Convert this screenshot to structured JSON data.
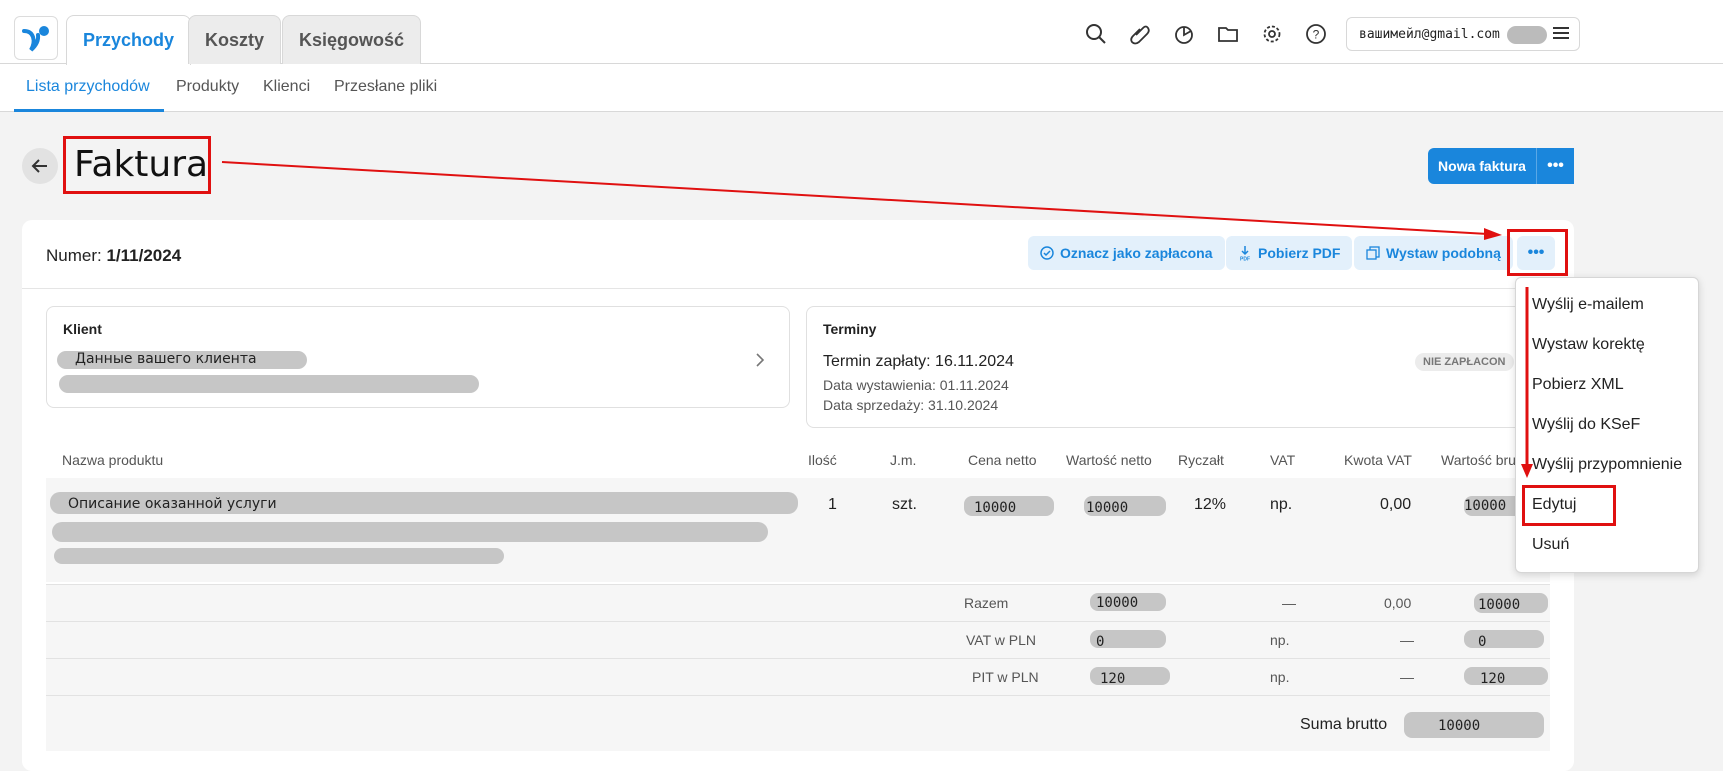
{
  "header": {
    "tabs": [
      {
        "label": "Przychody",
        "active": true
      },
      {
        "label": "Koszty",
        "active": false
      },
      {
        "label": "Księgowość",
        "active": false
      }
    ],
    "account_email": "вашимейл@gmail.com",
    "icons": [
      "search-icon",
      "paperclip-icon",
      "pie-chart-icon",
      "folder-icon",
      "gear-icon",
      "help-icon",
      "menu-icon"
    ]
  },
  "subnav": {
    "items": [
      {
        "label": "Lista przychodów",
        "active": true
      },
      {
        "label": "Produkty",
        "active": false
      },
      {
        "label": "Klienci",
        "active": false
      },
      {
        "label": "Przesłane pliki",
        "active": false
      }
    ]
  },
  "page": {
    "title": "Faktura",
    "new_button": "Nowa faktura",
    "more_glyph": "•••"
  },
  "invoice": {
    "numer_label": "Numer:",
    "numer_value": "1/11/2024",
    "actions": {
      "mark_paid": "Oznacz jako zapłacona",
      "download_pdf": "Pobierz PDF",
      "issue_similar": "Wystaw podobną"
    },
    "client": {
      "title": "Klient",
      "name": "Данные вашего клиента"
    },
    "terms": {
      "title": "Terminy",
      "payment_due": "Termin zapłaty: 16.11.2024",
      "issue_date": "Data wystawienia: 01.11.2024",
      "sale_date": "Data sprzedaży: 31.10.2024",
      "status_badge": "NIE ZAPŁACON"
    },
    "table": {
      "headers": [
        "Nazwa produktu",
        "Ilość",
        "J.m.",
        "Cena netto",
        "Wartość netto",
        "Ryczałt",
        "VAT",
        "Kwota VAT",
        "Wartość bru"
      ],
      "row": {
        "name": "Описание оказанной услуги",
        "qty": "1",
        "unit": "szt.",
        "price_net": "10000",
        "value_net": "10000",
        "lump": "12%",
        "vat": "np.",
        "vat_amount": "0,00",
        "value_gross": "10000"
      },
      "summary": [
        {
          "label": "Razem",
          "net": "10000",
          "vat": "—",
          "vat_amount": "0,00",
          "gross": "10000"
        },
        {
          "label": "VAT w PLN",
          "net": "0",
          "vat": "np.",
          "vat_amount": "—",
          "gross": "0"
        },
        {
          "label": "PIT w PLN",
          "net": "120",
          "vat": "np.",
          "vat_amount": "—",
          "gross": "120"
        }
      ],
      "total_label": "Suma brutto",
      "total_value": "10000"
    }
  },
  "dropdown": {
    "items": [
      "Wyślij e-mailem",
      "Wystaw korektę",
      "Pobierz XML",
      "Wyślij do KSeF",
      "Wyślij przypomnienie",
      "Edytuj",
      "Usuń"
    ]
  },
  "colors": {
    "accent": "#1a86dc",
    "annotation": "#e01010"
  }
}
